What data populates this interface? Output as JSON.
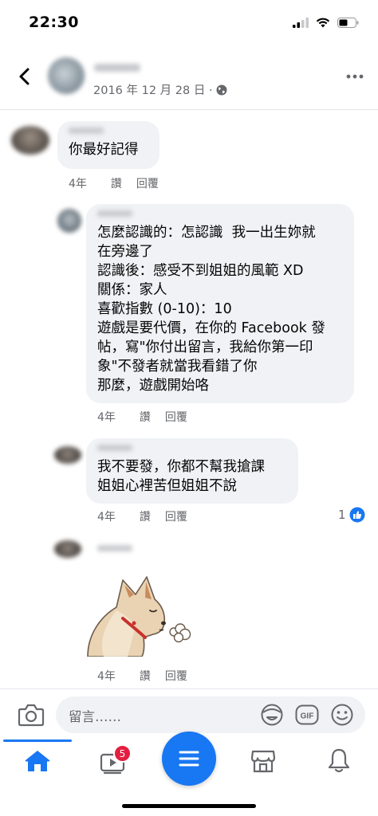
{
  "status_bar": {
    "time": "22:30"
  },
  "header": {
    "date": "2016 年 12 月 28 日 ·",
    "privacy_icon": "globe-icon",
    "more_icon": "more-horizontal-icon"
  },
  "comments": [
    {
      "text": "你最好記得",
      "time": "4年",
      "like": "讚",
      "reply": "回覆"
    },
    {
      "text": "怎麼認識的：怎認識  我一出生妳就\n在旁邊了\n認識後：感受不到姐姐的風範 XD\n關係：家人\n喜歡指數 (0-10)：10\n遊戲是要代價，在你的 Facebook 發\n帖，寫\"你付出留言，我給你第一印\n象\"不發者就當我看錯了你\n那麼，遊戲開始咯",
      "time": "4年",
      "like": "讚",
      "reply": "回覆"
    },
    {
      "text": "我不要發，你都不幫我搶課\n姐姐心裡苦但姐姐不說",
      "time": "4年",
      "like": "讚",
      "reply": "回覆",
      "reaction_count": "1"
    },
    {
      "sticker": "shiba-dog-sigh-sticker",
      "time": "4年",
      "like": "讚",
      "reply": "回覆"
    }
  ],
  "composer": {
    "placeholder": "留言……"
  },
  "tabbar": {
    "video_badge": "5"
  },
  "colors": {
    "accent": "#1877f2",
    "bubble": "#f0f2f5",
    "badge": "#e41e3f"
  }
}
